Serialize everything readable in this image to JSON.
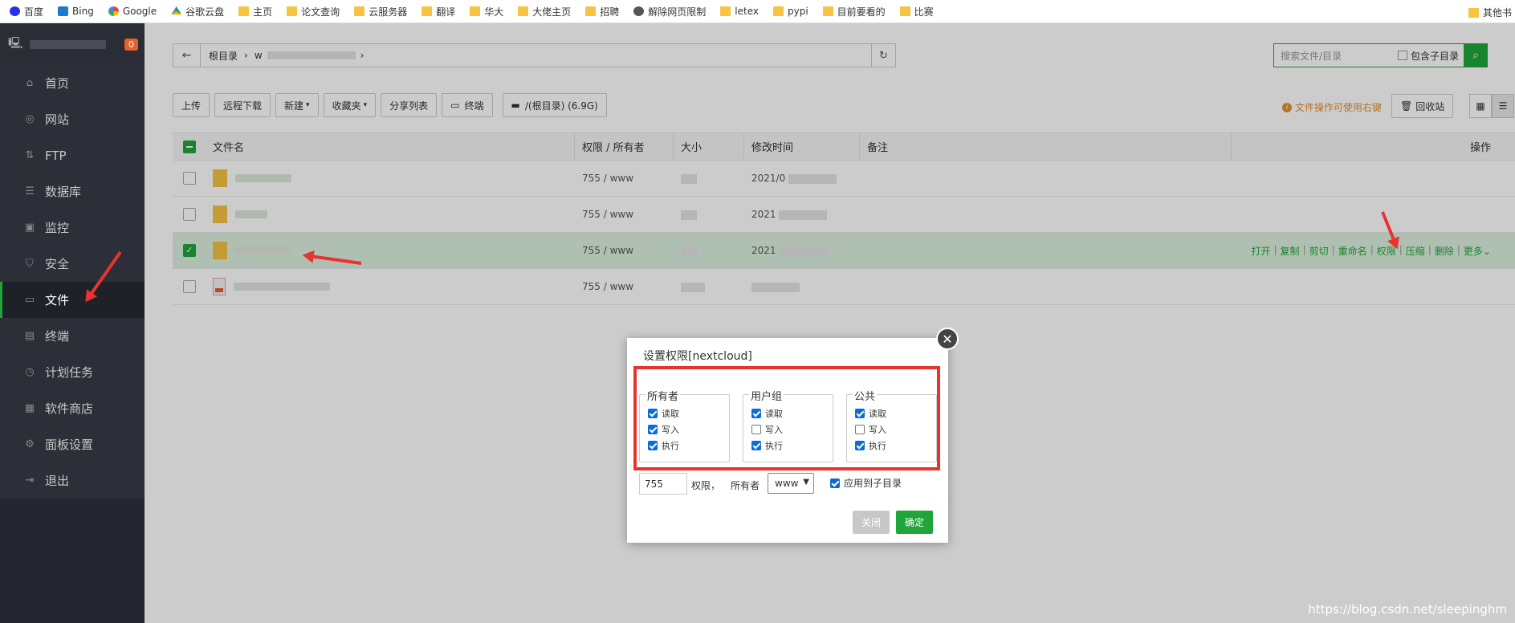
{
  "bookmarks": [
    {
      "label": "百度",
      "icon": "baidu-icon"
    },
    {
      "label": "Bing",
      "icon": "bing-icon"
    },
    {
      "label": "Google",
      "icon": "google-icon"
    },
    {
      "label": "谷歌云盘",
      "icon": "drive-icon"
    },
    {
      "label": "主页",
      "icon": "folder-icon"
    },
    {
      "label": "论文查询",
      "icon": "folder-icon"
    },
    {
      "label": "云服务器",
      "icon": "folder-icon"
    },
    {
      "label": "翻译",
      "icon": "folder-icon"
    },
    {
      "label": "华大",
      "icon": "folder-icon"
    },
    {
      "label": "大佬主页",
      "icon": "folder-icon"
    },
    {
      "label": "招聘",
      "icon": "folder-icon"
    },
    {
      "label": "解除网页限制",
      "icon": "globe-icon"
    },
    {
      "label": "letex",
      "icon": "folder-icon"
    },
    {
      "label": "pypi",
      "icon": "folder-icon"
    },
    {
      "label": "目前要看的",
      "icon": "folder-icon"
    },
    {
      "label": "比赛",
      "icon": "folder-icon"
    }
  ],
  "bookmarks_other": "其他书",
  "sidebar": {
    "badge": "0",
    "items": [
      {
        "label": "首页",
        "icon": "⌂"
      },
      {
        "label": "网站",
        "icon": "◎"
      },
      {
        "label": "FTP",
        "icon": "⇅"
      },
      {
        "label": "数据库",
        "icon": "☰"
      },
      {
        "label": "监控",
        "icon": "▣"
      },
      {
        "label": "安全",
        "icon": "⛉"
      },
      {
        "label": "文件",
        "icon": "▭"
      },
      {
        "label": "终端",
        "icon": "▤"
      },
      {
        "label": "计划任务",
        "icon": "◷"
      },
      {
        "label": "软件商店",
        "icon": "▦"
      },
      {
        "label": "面板设置",
        "icon": "⚙"
      },
      {
        "label": "退出",
        "icon": "⇥"
      }
    ]
  },
  "path": {
    "root": "根目录",
    "sep": "›",
    "sub": "w"
  },
  "search": {
    "placeholder": "搜索文件/目录",
    "include_sub": "包含子目录"
  },
  "toolbar": {
    "upload": "上传",
    "remote_download": "远程下载",
    "new": "新建",
    "favorites": "收藏夹",
    "share_list": "分享列表",
    "terminal": "终端",
    "disk": "/(根目录) (6.9G)"
  },
  "tip": "文件操作可使用右键",
  "recycle": "回收站",
  "table": {
    "headers": {
      "name": "文件名",
      "perm": "权限 / 所有者",
      "size": "大小",
      "time": "修改时间",
      "note": "备注",
      "op": "操作"
    },
    "rows": [
      {
        "perm": "755 / www",
        "time": "2021/0"
      },
      {
        "perm": "755 / www",
        "time": "2021"
      },
      {
        "perm": "755 / www",
        "time": "2021"
      },
      {
        "perm": "755 / www",
        "time": ""
      }
    ],
    "ops": [
      "打开",
      "复制",
      "剪切",
      "重命名",
      "权限",
      "压缩",
      "删除",
      "更多"
    ]
  },
  "dialog": {
    "title": "设置权限[nextcloud]",
    "groups": [
      {
        "name": "所有者",
        "perms": [
          {
            "label": "读取",
            "checked": true
          },
          {
            "label": "写入",
            "checked": true
          },
          {
            "label": "执行",
            "checked": true
          }
        ]
      },
      {
        "name": "用户组",
        "perms": [
          {
            "label": "读取",
            "checked": true
          },
          {
            "label": "写入",
            "checked": false
          },
          {
            "label": "执行",
            "checked": true
          }
        ]
      },
      {
        "name": "公共",
        "perms": [
          {
            "label": "读取",
            "checked": true
          },
          {
            "label": "写入",
            "checked": false
          },
          {
            "label": "执行",
            "checked": true
          }
        ]
      }
    ],
    "perm_value": "755",
    "perm_label": "权限，",
    "owner_label": "所有者",
    "owner_value": "www",
    "apply_sub": "应用到子目录",
    "close_btn": "关闭",
    "ok_btn": "确定"
  },
  "watermark": "https://blog.csdn.net/sleepinghm",
  "colors": {
    "accent": "#20a53a",
    "annotation": "#e8342f"
  }
}
